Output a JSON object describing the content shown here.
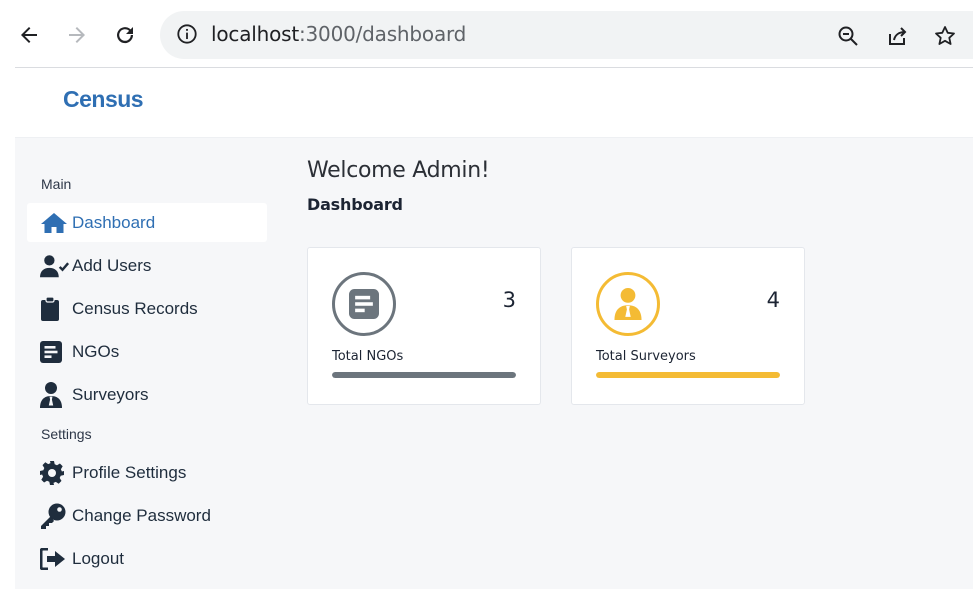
{
  "browser": {
    "url_host": "localhost",
    "url_path": ":3000/dashboard",
    "icons": [
      "back-arrow-icon",
      "forward-arrow-icon",
      "reload-icon",
      "info-icon",
      "zoom-out-icon",
      "share-icon",
      "bookmark-star-icon"
    ]
  },
  "header": {
    "brand": "Census",
    "brand_color": "#2f6fb3"
  },
  "sidebar": {
    "sections": [
      {
        "title": "Main"
      },
      {
        "title": "Settings"
      }
    ],
    "items": [
      {
        "label": "Dashboard",
        "icon": "home-icon",
        "active": true
      },
      {
        "label": "Add Users",
        "icon": "user-check-icon",
        "active": false
      },
      {
        "label": "Census Records",
        "icon": "clipboard-icon",
        "active": false
      },
      {
        "label": "NGOs",
        "icon": "document-list-icon",
        "active": false
      },
      {
        "label": "Surveyors",
        "icon": "user-tie-icon",
        "active": false
      },
      {
        "label": "Profile Settings",
        "icon": "gear-icon",
        "active": false
      },
      {
        "label": "Change Password",
        "icon": "key-icon",
        "active": false
      },
      {
        "label": "Logout",
        "icon": "logout-icon",
        "active": false
      }
    ]
  },
  "main": {
    "welcome": "Welcome Admin!",
    "subtitle": "Dashboard",
    "cards": [
      {
        "label": "Total NGOs",
        "count": "3",
        "icon": "document-list-icon",
        "color": "#6c757d",
        "progress": 1.0
      },
      {
        "label": "Total Surveyors",
        "count": "4",
        "icon": "user-tie-icon",
        "color": "#f4bb34",
        "progress": 1.0
      }
    ]
  },
  "colors": {
    "accent": "#2f6fb3",
    "sidebar_text": "#1f2d3d",
    "background": "#f6f7f9"
  }
}
